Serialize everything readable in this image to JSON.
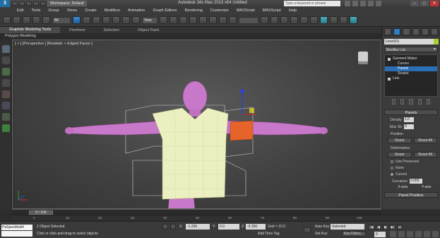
{
  "window": {
    "title": "Autodesk 3ds Max 2013 x64     Untitled",
    "workspace": "Workspace: Default",
    "search_placeholder": "Type a keyword or phrase",
    "buttons": [
      "–",
      "□",
      "✕"
    ]
  },
  "menu": [
    "Edit",
    "Tools",
    "Group",
    "Views",
    "Create",
    "Modifiers",
    "Animation",
    "Graph Editors",
    "Rendering",
    "Customize",
    "MAXScript",
    "MAXScript",
    "Help"
  ],
  "toolbar": {
    "selection_filter": "All",
    "reference_coord": "View"
  },
  "ribbon": {
    "tabs": [
      "Graphite Modeling Tools",
      "Freeform",
      "Selection",
      "Object Paint"
    ],
    "sub_label": "Polygon Modeling"
  },
  "viewport": {
    "label": "[ + ] [Perspective ] [Realistic + Edged Faces ]"
  },
  "command_panel": {
    "object_name": "Line001",
    "modifier_list": "Modifier List",
    "stack": [
      {
        "label": "Garment Maker",
        "level": 0
      },
      {
        "label": "Curves",
        "level": 1
      },
      {
        "label": "Panels",
        "level": 1,
        "selected": true
      },
      {
        "label": "Seams",
        "level": 1
      },
      {
        "label": "Line",
        "level": 0
      }
    ],
    "rollout_title": "Panels",
    "density_label": "Density",
    "density_value": "1.0",
    "maxsb_label": "Max Sb",
    "maxsb_value": "0",
    "position_label": "Position",
    "reset_label": "Reset",
    "reset_all_label": "Reset All",
    "deformation_label": "Deformation",
    "use_preserved_label": "Use Preserved",
    "none_label": "None",
    "curved_label": "Curved",
    "curvature_label": "Curvature",
    "curvature_value": "0.000",
    "x_axis_label": "X-axis",
    "y_axis_label": "Y-axis",
    "panel_position_label": "Panel Position"
  },
  "timeline": {
    "slider_label": "0 / 100",
    "ticks": [
      "0",
      "10",
      "20",
      "30",
      "40",
      "50",
      "60",
      "70",
      "80",
      "90",
      "100"
    ]
  },
  "status": {
    "maxscript_text": "PaSpexModifi",
    "selection_info": "1 Object Selected",
    "prompt": "Click or click-and-drag to select objects",
    "x_label": "X:",
    "x_value": "-1.256",
    "y_label": "Y:",
    "y_value": "0.0",
    "z_label": "Z:",
    "z_value": "-0.356",
    "grid": "Grid = 10.0",
    "add_time_tag": "Add Time Tag",
    "auto_key": "Auto Key",
    "set_key": "Set Key",
    "selected_dropdown": "Selected",
    "key_filters": "Key Filters...",
    "frame_value": "0",
    "play_buttons": [
      "|◀",
      "◀",
      "▶",
      "▶|",
      "⏭"
    ]
  }
}
